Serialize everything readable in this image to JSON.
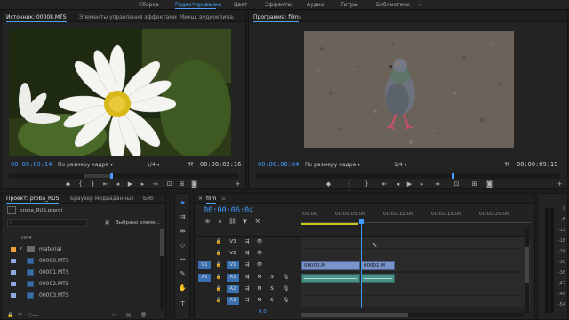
{
  "workspace_tabs": [
    "Сборка",
    "Редактирование",
    "Цвет",
    "Эффекты",
    "Аудио",
    "Титры",
    "Библиотеки"
  ],
  "active_workspace": "Редактирование",
  "source_monitor": {
    "tabs": [
      "Источник: 00008.MTS",
      "Элементы управления эффектами",
      "Микш. аудиоклипа:"
    ],
    "timecode": "00:00:09:14",
    "fit": "По размеру кадра",
    "resolution": "1/4",
    "duration": "00:00:02:16"
  },
  "program_monitor": {
    "tab": "Программа: film",
    "timecode": "00:00:06:04",
    "fit": "По размеру кадра",
    "resolution": "1/4",
    "duration": "00:00:09:19"
  },
  "project_panel": {
    "tabs": [
      "Проект: proba_RUS",
      "Браузер медиаданных",
      "Биб"
    ],
    "project_file": "proba_RUS.prproj",
    "selection_label": "Выбрано элеме...",
    "column_header": "Имя",
    "folder": "material",
    "files": [
      "00000.MTS",
      "00001.MTS",
      "00002.MTS",
      "00003.MTS"
    ],
    "bottom_value": "0.0"
  },
  "timeline": {
    "tab": "film",
    "timecode": "00:00:06:04",
    "ruler": [
      ":00:00",
      "00:00:05:00",
      "00:00:10:00",
      "00:00:15:00",
      "00:00:20:00"
    ],
    "video_tracks": [
      {
        "src": "",
        "name": "V3"
      },
      {
        "src": "",
        "name": "V2"
      },
      {
        "src": "V1",
        "name": "V1"
      }
    ],
    "audio_tracks": [
      {
        "src": "A1",
        "name": "A1"
      },
      {
        "src": "",
        "name": "A2"
      },
      {
        "src": "",
        "name": "A3"
      }
    ],
    "clips": [
      "00000.M",
      "00001.M"
    ],
    "mute_label": "M",
    "solo_label": "S",
    "playhead_seconds": 6.17
  },
  "meter_scale": [
    "0",
    "-6",
    "-12",
    "-18",
    "-24",
    "-30",
    "-36",
    "-42",
    "-48",
    "-54"
  ],
  "colors": {
    "accent": "#3f9bff",
    "video_clip": "#7a93c8",
    "audio_clip": "#4d8f8a",
    "swatch_folder": "#e8a13b",
    "swatch_file": "#8fa8e0"
  }
}
